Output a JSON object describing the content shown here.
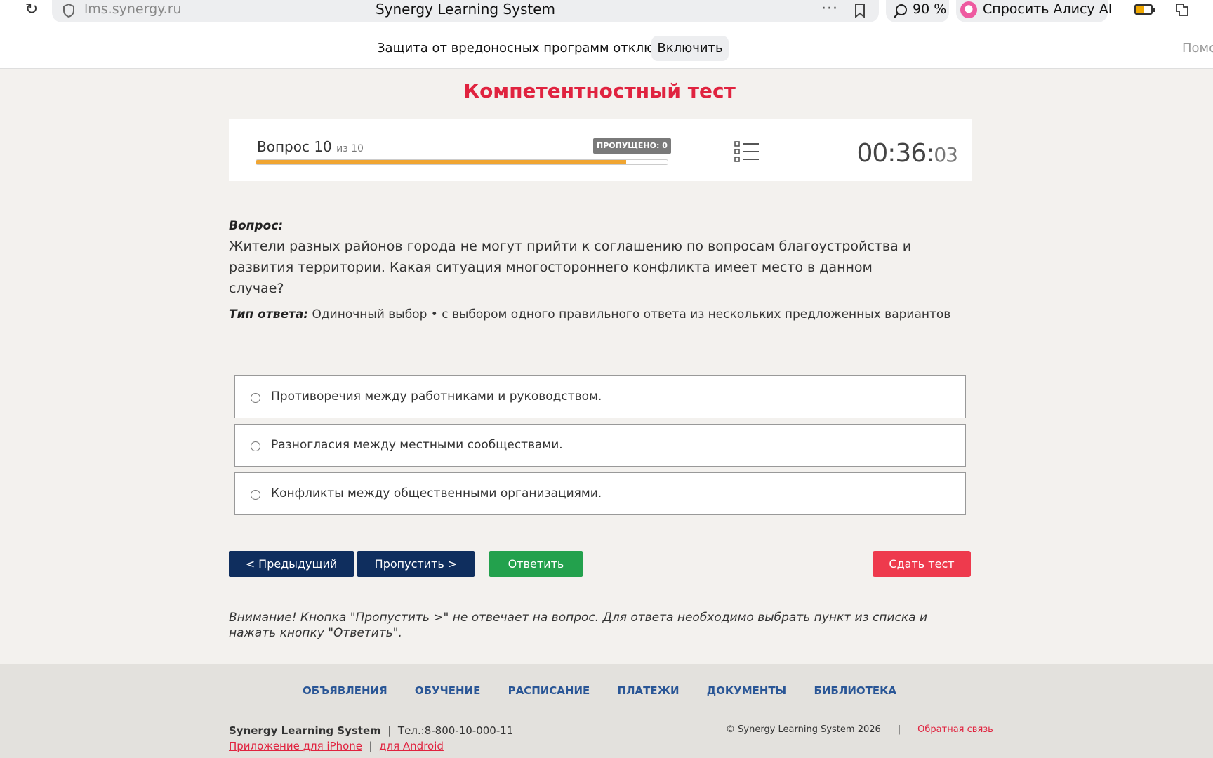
{
  "browser": {
    "url": "lms.synergy.ru",
    "page_title": "Synergy Learning System",
    "zoom": "90 %",
    "assistant_label": "Спросить Алису AI"
  },
  "protection": {
    "message": "Защита от вредоносных программ отключена",
    "enable_label": "Включить",
    "help_label": "Помо"
  },
  "test": {
    "title": "Компетентностный тест",
    "question_label": "Вопрос 10",
    "question_of": "из 10",
    "skipped_badge": "ПРОПУЩЕНО: 0",
    "progress_fraction": 0.9,
    "timer_main": "00:36:",
    "timer_seconds": "03"
  },
  "question": {
    "label": "Вопрос:",
    "text": "Жители разных районов города не могут прийти к соглашению по вопросам благоустройства и развития территории. Какая ситуация многостороннего конфликта имеет место в данном случае?",
    "answer_type_label": "Тип ответа:",
    "answer_type_value": " Одиночный выбор • с выбором одного правильного ответа из нескольких предложенных вариантов"
  },
  "options": [
    "Противоречия между работниками и руководством.",
    "Разногласия между местными сообществами.",
    "Конфликты между общественными организациями."
  ],
  "buttons": {
    "prev": "< Предыдущий",
    "skip": "Пропустить >",
    "answer": "Ответить",
    "submit": "Сдать тест"
  },
  "warning": "Внимание! Кнопка \"Пропустить >\" не отвечает на вопрос. Для ответа необходимо выбрать пункт из списка и нажать кнопку \"Ответить\".",
  "footer": {
    "nav": [
      "ОБЪЯВЛЕНИЯ",
      "ОБУЧЕНИЕ",
      "РАСПИСАНИЕ",
      "ПЛАТЕЖИ",
      "ДОКУМЕНТЫ",
      "БИБЛИОТЕКА"
    ],
    "brand": "Synergy Learning System",
    "phone": "Тел.:8-800-10-000-11",
    "app_iphone": "Приложение для iPhone",
    "app_android": "для Android",
    "copyright": "© Synergy Learning System 2026",
    "feedback": "Обратная связь"
  },
  "colors": {
    "accent_red": "#e0233f",
    "nav_blue": "#0f2e5e",
    "answer_green": "#23a14d",
    "submit_red": "#ee3a4d",
    "progress_orange": "#f0a531"
  },
  "icons": [
    "reload-icon",
    "shield-icon",
    "more-dots-icon",
    "bookmark-icon",
    "zoom-icon",
    "alice-icon",
    "battery-icon",
    "extension-icon",
    "question-list-icon",
    "radio-icon"
  ]
}
